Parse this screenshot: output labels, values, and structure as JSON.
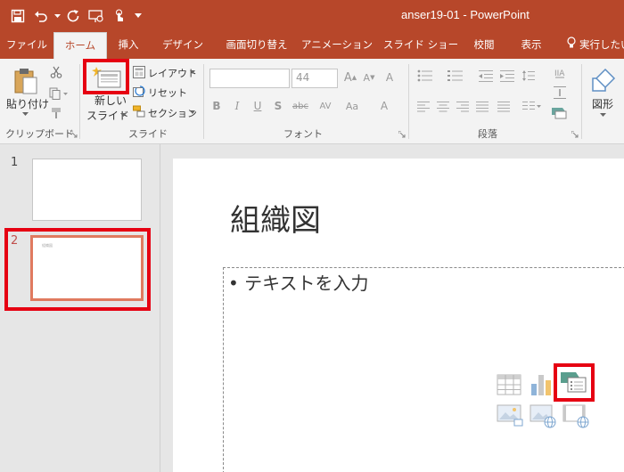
{
  "app": {
    "window_title": "anser19-01  -  PowerPoint",
    "brand_color": "#b7472a",
    "highlight_color": "#e60012"
  },
  "tabs": [
    {
      "label": "ファイル"
    },
    {
      "label": "ホーム",
      "active": true
    },
    {
      "label": "挿入"
    },
    {
      "label": "デザイン"
    },
    {
      "label": "画面切り替え"
    },
    {
      "label": "アニメーション"
    },
    {
      "label": "スライド ショー"
    },
    {
      "label": "校閲"
    },
    {
      "label": "表示"
    },
    {
      "label": "実行したい"
    }
  ],
  "ribbon": {
    "clipboard": {
      "paste_label": "貼り付け",
      "group_label": "クリップボード"
    },
    "slides": {
      "new_slide_line1": "新しい",
      "new_slide_line2": "スライド",
      "layout_label": "レイアウト",
      "reset_label": "リセット",
      "section_label": "セクション",
      "group_label": "スライド"
    },
    "font": {
      "font_name": "",
      "font_size": "44",
      "group_label": "フォント"
    },
    "paragraph": {
      "group_label": "段落"
    },
    "drawing": {
      "shape_label": "図形"
    }
  },
  "thumbnails": [
    {
      "number": "1",
      "selected": false
    },
    {
      "number": "2",
      "selected": true,
      "mini_title": "組織図"
    }
  ],
  "slide": {
    "title": "組織図",
    "bullet": "• テキストを入力"
  }
}
